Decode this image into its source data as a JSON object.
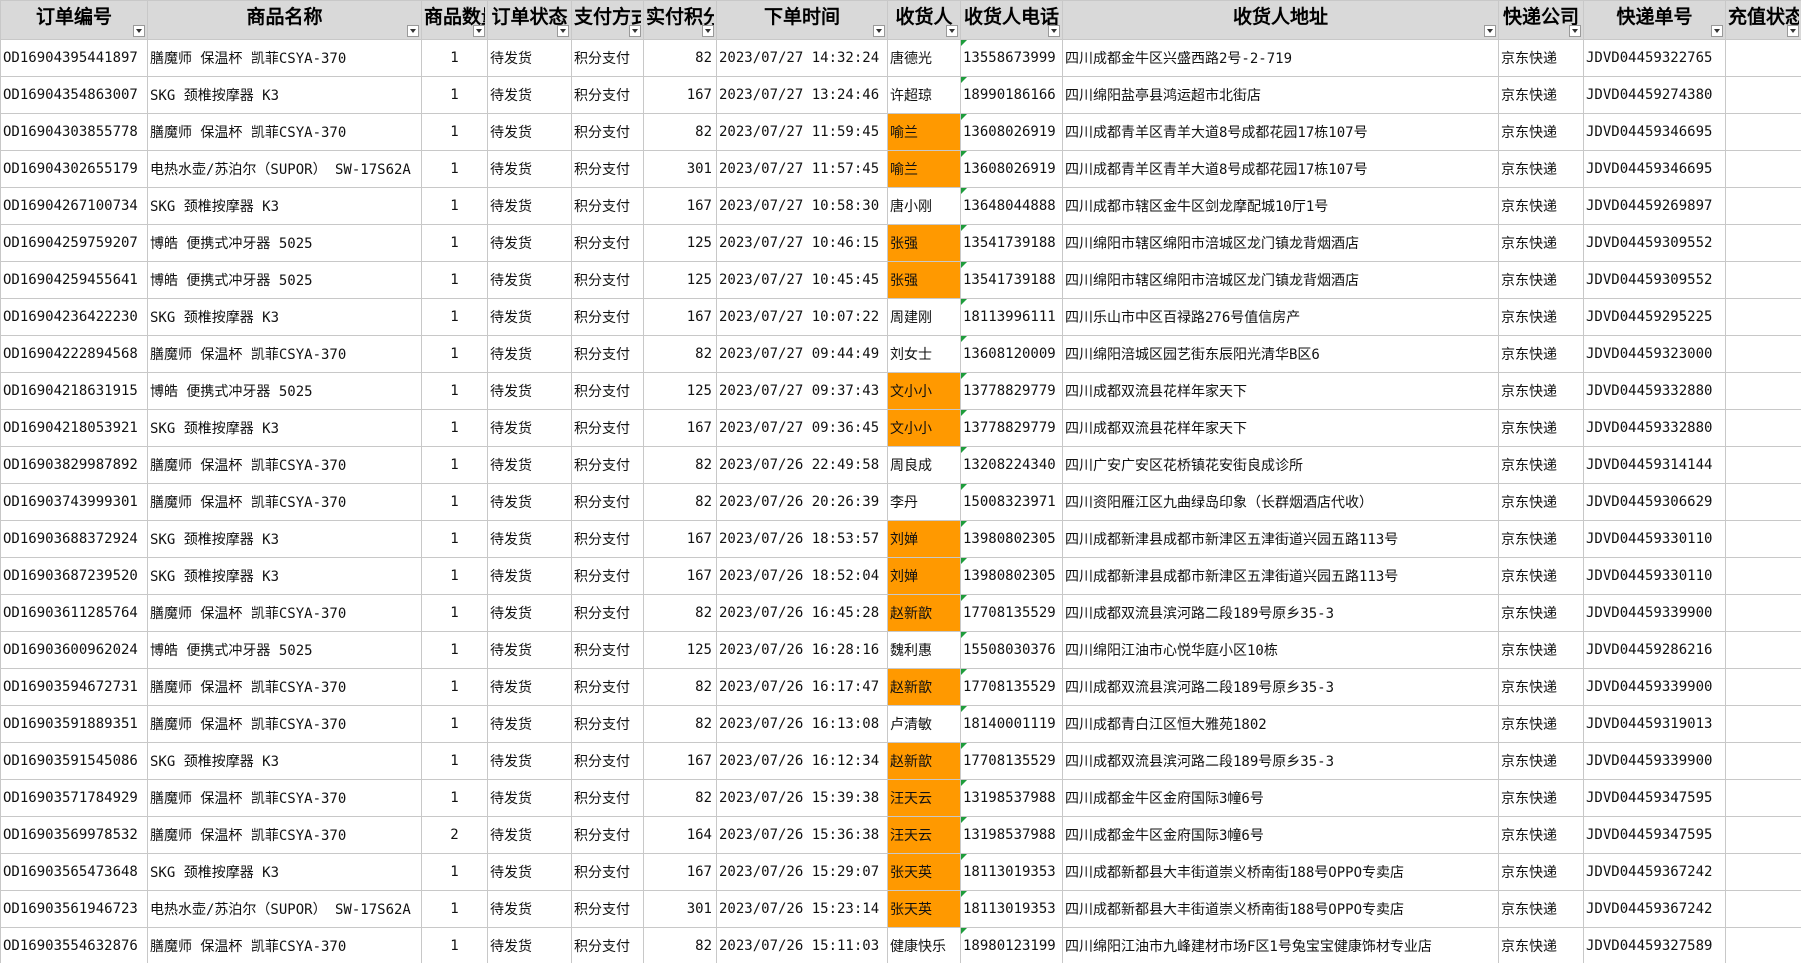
{
  "columns": [
    "订单编号",
    "商品名称",
    "商品数量",
    "订单状态",
    "支付方式",
    "实付积分",
    "下单时间",
    "收货人",
    "收货人电话",
    "收货人地址",
    "快递公司",
    "快递单号",
    "充值状态"
  ],
  "highlight_color": "#ff9900",
  "rows": [
    [
      "OD16904395441897",
      "膳魔师 保温杯 凯菲CSYA-370",
      "1",
      "待发货",
      "积分支付",
      "82",
      "2023/07/27 14:32:24",
      "唐德光",
      "13558673999",
      "四川成都金牛区兴盛西路2号-2-719",
      "京东快递",
      "JDVD04459322765",
      ""
    ],
    [
      "OD16904354863007",
      "SKG 颈椎按摩器 K3",
      "1",
      "待发货",
      "积分支付",
      "167",
      "2023/07/27 13:24:46",
      "许超琼",
      "18990186166",
      "四川绵阳盐亭县鸿运超市北街店",
      "京东快递",
      "JDVD04459274380",
      ""
    ],
    [
      "OD16904303855778",
      "膳魔师 保温杯 凯菲CSYA-370",
      "1",
      "待发货",
      "积分支付",
      "82",
      "2023/07/27 11:59:45",
      "喻兰",
      "13608026919",
      "四川成都青羊区青羊大道8号成都花园17栋107号",
      "京东快递",
      "JDVD04459346695",
      ""
    ],
    [
      "OD16904302655179",
      "电热水壶/苏泊尔（SUPOR） SW-17S62A",
      "1",
      "待发货",
      "积分支付",
      "301",
      "2023/07/27 11:57:45",
      "喻兰",
      "13608026919",
      "四川成都青羊区青羊大道8号成都花园17栋107号",
      "京东快递",
      "JDVD04459346695",
      ""
    ],
    [
      "OD16904267100734",
      "SKG 颈椎按摩器 K3",
      "1",
      "待发货",
      "积分支付",
      "167",
      "2023/07/27 10:58:30",
      "唐小刚",
      "13648044888",
      "四川成都市辖区金牛区剑龙摩配城10厅1号",
      "京东快递",
      "JDVD04459269897",
      ""
    ],
    [
      "OD16904259759207",
      "博皓 便携式冲牙器 5025",
      "1",
      "待发货",
      "积分支付",
      "125",
      "2023/07/27 10:46:15",
      "张强",
      "13541739188",
      "四川绵阳市辖区绵阳市涪城区龙门镇龙背烟酒店",
      "京东快递",
      "JDVD04459309552",
      ""
    ],
    [
      "OD16904259455641",
      "博皓 便携式冲牙器 5025",
      "1",
      "待发货",
      "积分支付",
      "125",
      "2023/07/27 10:45:45",
      "张强",
      "13541739188",
      "四川绵阳市辖区绵阳市涪城区龙门镇龙背烟酒店",
      "京东快递",
      "JDVD04459309552",
      ""
    ],
    [
      "OD16904236422230",
      "SKG 颈椎按摩器 K3",
      "1",
      "待发货",
      "积分支付",
      "167",
      "2023/07/27 10:07:22",
      "周建刚",
      "18113996111",
      "四川乐山市中区百禄路276号值信房产",
      "京东快递",
      "JDVD04459295225",
      ""
    ],
    [
      "OD16904222894568",
      "膳魔师 保温杯 凯菲CSYA-370",
      "1",
      "待发货",
      "积分支付",
      "82",
      "2023/07/27 09:44:49",
      "刘女士",
      "13608120009",
      "四川绵阳涪城区园艺街东辰阳光清华B区6",
      "京东快递",
      "JDVD04459323000",
      ""
    ],
    [
      "OD16904218631915",
      "博皓 便携式冲牙器 5025",
      "1",
      "待发货",
      "积分支付",
      "125",
      "2023/07/27 09:37:43",
      "文小小",
      "13778829779",
      "四川成都双流县花样年家天下",
      "京东快递",
      "JDVD04459332880",
      ""
    ],
    [
      "OD16904218053921",
      "SKG 颈椎按摩器 K3",
      "1",
      "待发货",
      "积分支付",
      "167",
      "2023/07/27 09:36:45",
      "文小小",
      "13778829779",
      "四川成都双流县花样年家天下",
      "京东快递",
      "JDVD04459332880",
      ""
    ],
    [
      "OD16903829987892",
      "膳魔师 保温杯 凯菲CSYA-370",
      "1",
      "待发货",
      "积分支付",
      "82",
      "2023/07/26 22:49:58",
      "周良成",
      "13208224340",
      "四川广安广安区花桥镇花安街良成诊所",
      "京东快递",
      "JDVD04459314144",
      ""
    ],
    [
      "OD16903743999301",
      "膳魔师 保温杯 凯菲CSYA-370",
      "1",
      "待发货",
      "积分支付",
      "82",
      "2023/07/26 20:26:39",
      "李丹",
      "15008323971",
      "四川资阳雁江区九曲绿岛印象（长群烟酒店代收）",
      "京东快递",
      "JDVD04459306629",
      ""
    ],
    [
      "OD16903688372924",
      "SKG 颈椎按摩器 K3",
      "1",
      "待发货",
      "积分支付",
      "167",
      "2023/07/26 18:53:57",
      "刘婵",
      "13980802305",
      "四川成都新津县成都市新津区五津街道兴园五路113号",
      "京东快递",
      "JDVD04459330110",
      ""
    ],
    [
      "OD16903687239520",
      "SKG 颈椎按摩器 K3",
      "1",
      "待发货",
      "积分支付",
      "167",
      "2023/07/26 18:52:04",
      "刘婵",
      "13980802305",
      "四川成都新津县成都市新津区五津街道兴园五路113号",
      "京东快递",
      "JDVD04459330110",
      ""
    ],
    [
      "OD16903611285764",
      "膳魔师 保温杯 凯菲CSYA-370",
      "1",
      "待发货",
      "积分支付",
      "82",
      "2023/07/26 16:45:28",
      "赵新歆",
      "17708135529",
      "四川成都双流县滨河路二段189号原乡35-3",
      "京东快递",
      "JDVD04459339900",
      ""
    ],
    [
      "OD16903600962024",
      "博皓 便携式冲牙器 5025",
      "1",
      "待发货",
      "积分支付",
      "125",
      "2023/07/26 16:28:16",
      "魏利惠",
      "15508030376",
      "四川绵阳江油市心悦华庭小区10栋",
      "京东快递",
      "JDVD04459286216",
      ""
    ],
    [
      "OD16903594672731",
      "膳魔师 保温杯 凯菲CSYA-370",
      "1",
      "待发货",
      "积分支付",
      "82",
      "2023/07/26 16:17:47",
      "赵新歆",
      "17708135529",
      "四川成都双流县滨河路二段189号原乡35-3",
      "京东快递",
      "JDVD04459339900",
      ""
    ],
    [
      "OD16903591889351",
      "膳魔师 保温杯 凯菲CSYA-370",
      "1",
      "待发货",
      "积分支付",
      "82",
      "2023/07/26 16:13:08",
      "卢清敏",
      "18140001119",
      "四川成都青白江区恒大雅苑1802",
      "京东快递",
      "JDVD04459319013",
      ""
    ],
    [
      "OD16903591545086",
      "SKG 颈椎按摩器 K3",
      "1",
      "待发货",
      "积分支付",
      "167",
      "2023/07/26 16:12:34",
      "赵新歆",
      "17708135529",
      "四川成都双流县滨河路二段189号原乡35-3",
      "京东快递",
      "JDVD04459339900",
      ""
    ],
    [
      "OD16903571784929",
      "膳魔师 保温杯 凯菲CSYA-370",
      "1",
      "待发货",
      "积分支付",
      "82",
      "2023/07/26 15:39:38",
      "汪天云",
      "13198537988",
      "四川成都金牛区金府国际3幢6号",
      "京东快递",
      "JDVD04459347595",
      ""
    ],
    [
      "OD16903569978532",
      "膳魔师 保温杯 凯菲CSYA-370",
      "2",
      "待发货",
      "积分支付",
      "164",
      "2023/07/26 15:36:38",
      "汪天云",
      "13198537988",
      "四川成都金牛区金府国际3幢6号",
      "京东快递",
      "JDVD04459347595",
      ""
    ],
    [
      "OD16903565473648",
      "SKG 颈椎按摩器 K3",
      "1",
      "待发货",
      "积分支付",
      "167",
      "2023/07/26 15:29:07",
      "张天英",
      "18113019353",
      "四川成都新都县大丰街道崇义桥南街188号OPPO专卖店",
      "京东快递",
      "JDVD04459367242",
      ""
    ],
    [
      "OD16903561946723",
      "电热水壶/苏泊尔（SUPOR） SW-17S62A",
      "1",
      "待发货",
      "积分支付",
      "301",
      "2023/07/26 15:23:14",
      "张天英",
      "18113019353",
      "四川成都新都县大丰街道崇义桥南街188号OPPO专卖店",
      "京东快递",
      "JDVD04459367242",
      ""
    ],
    [
      "OD16903554632876",
      "膳魔师 保温杯 凯菲CSYA-370",
      "1",
      "待发货",
      "积分支付",
      "82",
      "2023/07/26 15:11:03",
      "健康快乐",
      "18980123199",
      "四川绵阳江油市九峰建材市场F区1号兔宝宝健康饰材专业店",
      "京东快递",
      "JDVD04459327589",
      ""
    ]
  ],
  "highlighted_rows": [
    2,
    3,
    5,
    6,
    9,
    10,
    13,
    14,
    15,
    17,
    19,
    20,
    21,
    22,
    23
  ]
}
